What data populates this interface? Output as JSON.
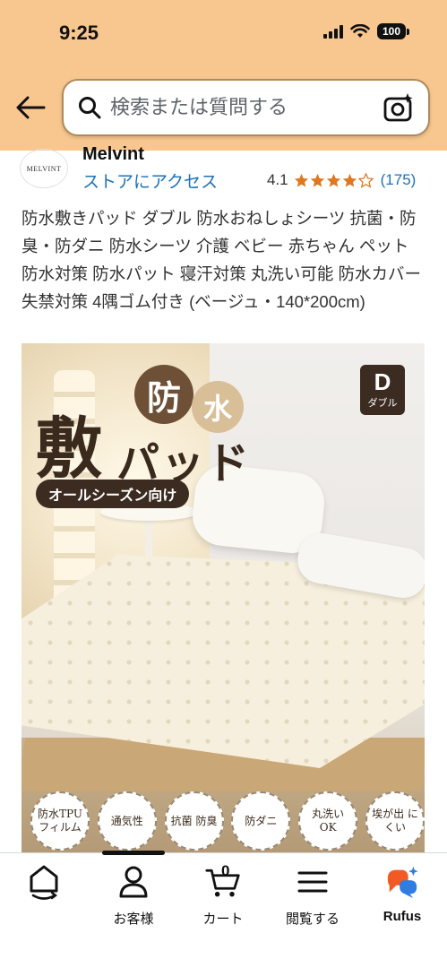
{
  "status_bar": {
    "time": "9:25",
    "battery": "100"
  },
  "search": {
    "placeholder": "検索または質問する"
  },
  "store": {
    "logo_text": "MELVINT",
    "name": "Melvint",
    "link": "ストアにアクセス",
    "rating": "4.1",
    "stars": 4,
    "review_count": "(175)"
  },
  "product": {
    "title": "防水敷きパッド ダブル 防水おねしょシーツ 抗菌・防臭・防ダニ 防水シーツ 介護 ベビー 赤ちゃん ペット 防水対策 防水パット 寝汗対策 丸洗い可能 防水カバー 失禁対策 4隅ゴム付き (ベージュ・140*200cm)"
  },
  "image_text": {
    "kanji_bo": "防",
    "kanji_sui": "水",
    "shiki": "敷",
    "pad": "パッド",
    "season": "オールシーズン向け",
    "size_letter": "D",
    "size_label": "ダブル",
    "features": [
      "防水TPU フィルム",
      "通気性",
      "抗菌 防臭",
      "防ダニ",
      "丸洗い OK",
      "埃が出 にくい"
    ]
  },
  "bottom_nav": {
    "home_label": "",
    "account_label": "お客様",
    "cart_label": "カート",
    "cart_count": "0",
    "browse_label": "閲覧する",
    "rufus_label": "Rufus"
  },
  "colors": {
    "header_bg": "#f7c78f",
    "link": "#1b72b8",
    "star": "#de7921"
  }
}
